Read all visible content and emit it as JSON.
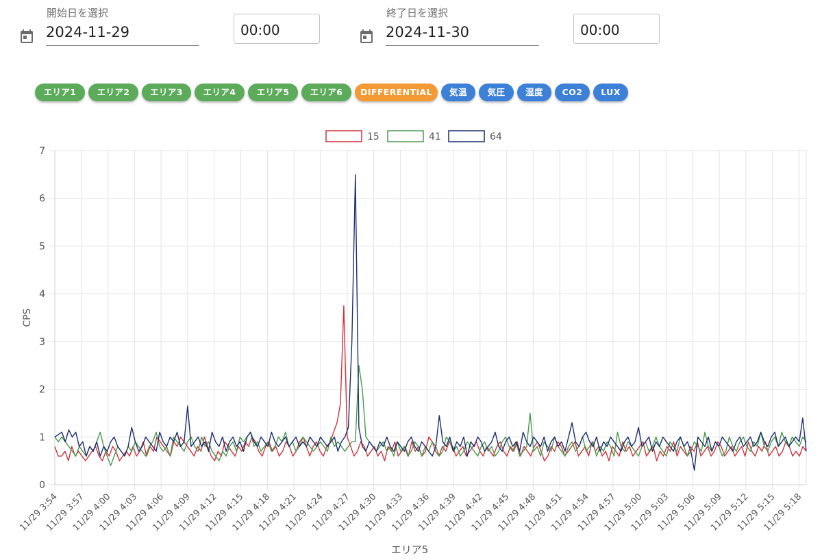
{
  "start": {
    "label": "開始日を選択",
    "date": "2024-11-29",
    "time": "00:00",
    "icon": "calendar-icon"
  },
  "end": {
    "label": "終了日を選択",
    "date": "2024-11-30",
    "time": "00:00",
    "icon": "calendar-icon"
  },
  "chips": [
    {
      "label": "エリア1",
      "color": "#5cab5a"
    },
    {
      "label": "エリア2",
      "color": "#5cab5a"
    },
    {
      "label": "エリア3",
      "color": "#5cab5a"
    },
    {
      "label": "エリア4",
      "color": "#5cab5a"
    },
    {
      "label": "エリア5",
      "color": "#5cab5a"
    },
    {
      "label": "エリア6",
      "color": "#5cab5a"
    },
    {
      "label": "DIFFERENTIAL",
      "color": "#f39a35"
    },
    {
      "label": "気温",
      "color": "#3c80d8"
    },
    {
      "label": "気圧",
      "color": "#3c80d8"
    },
    {
      "label": "湿度",
      "color": "#3c80d8"
    },
    {
      "label": "CO2",
      "color": "#3c80d8"
    },
    {
      "label": "LUX",
      "color": "#3c80d8"
    }
  ],
  "chart_data": {
    "type": "line",
    "title": "",
    "xlabel": "エリア5",
    "ylabel": "CPS",
    "ylim": [
      0,
      7
    ],
    "yticks": [
      0,
      1,
      2,
      3,
      4,
      5,
      6,
      7
    ],
    "grid": true,
    "legend_position": "top-center",
    "x_categories": [
      "11/29 3:54",
      "11/29 3:57",
      "11/29 4:00",
      "11/29 4:03",
      "11/29 4:06",
      "11/29 4:09",
      "11/29 4:12",
      "11/29 4:15",
      "11/29 4:18",
      "11/29 4:21",
      "11/29 4:24",
      "11/29 4:27",
      "11/29 4:30",
      "11/29 4:33",
      "11/29 4:36",
      "11/29 4:39",
      "11/29 4:42",
      "11/29 4:45",
      "11/29 4:48",
      "11/29 4:51",
      "11/29 4:54",
      "11/29 4:57",
      "11/29 5:00",
      "11/29 5:03",
      "11/29 5:06",
      "11/29 5:09",
      "11/29 5:12",
      "11/29 5:15",
      "11/29 5:18"
    ],
    "series": [
      {
        "name": "15",
        "color": "#d0323c",
        "values": [
          0.8,
          0.6,
          0.6,
          0.7,
          0.5,
          0.8,
          0.6,
          0.7,
          0.6,
          0.5,
          0.6,
          0.7,
          0.8,
          0.6,
          0.5,
          0.7,
          0.6,
          0.8,
          0.7,
          0.5,
          0.6,
          0.7,
          0.6,
          0.8,
          0.6,
          0.7,
          0.9,
          0.6,
          0.8,
          0.7,
          1.0,
          0.9,
          0.8,
          0.7,
          0.6,
          0.9,
          0.8,
          1.0,
          0.9,
          0.8,
          0.7,
          0.6,
          0.8,
          0.7,
          1.0,
          0.8,
          0.6,
          0.5,
          0.7,
          0.6,
          0.9,
          0.8,
          0.7,
          0.6,
          0.8,
          0.7,
          0.9,
          0.8,
          1.0,
          0.9,
          0.7,
          0.6,
          0.8,
          0.9,
          0.7,
          0.8,
          0.6,
          0.7,
          0.9,
          0.8,
          0.6,
          0.7,
          0.9,
          1.0,
          0.8,
          0.6,
          0.8,
          0.9,
          0.7,
          0.6,
          0.8,
          0.9,
          1.1,
          1.3,
          1.7,
          3.75,
          1.0,
          0.8,
          0.6,
          0.7,
          0.9,
          0.8,
          0.6,
          0.7,
          0.8,
          0.6,
          0.7,
          0.5,
          0.8,
          0.7,
          0.9,
          0.6,
          0.7,
          0.8,
          0.6,
          0.9,
          0.7,
          0.8,
          0.6,
          0.7,
          1.0,
          0.9,
          0.7,
          0.6,
          0.8,
          0.7,
          0.9,
          0.8,
          0.6,
          0.7,
          0.8,
          0.6,
          0.7,
          0.8,
          0.9,
          0.7,
          0.6,
          0.8,
          0.7,
          0.6,
          0.8,
          0.9,
          0.7,
          0.6,
          0.8,
          0.7,
          0.9,
          0.6,
          0.8,
          0.7,
          0.6,
          0.8,
          0.9,
          0.7,
          0.5,
          0.6,
          0.8,
          0.7,
          0.9,
          0.8,
          0.6,
          0.7,
          0.8,
          0.9,
          0.6,
          0.7,
          0.8,
          0.6,
          0.9,
          0.7,
          0.8,
          0.6,
          0.7,
          0.5,
          0.8,
          0.7,
          0.6,
          0.9,
          0.7,
          0.8,
          0.6,
          0.7,
          0.8,
          0.9,
          0.6,
          0.7,
          0.8,
          0.5,
          0.7,
          0.6,
          0.8,
          0.7,
          0.9,
          0.6,
          0.8,
          0.7,
          0.6,
          0.8,
          0.7,
          0.9,
          0.6,
          0.7,
          0.8,
          0.6,
          0.7,
          0.9,
          0.8,
          0.6,
          0.7,
          0.8,
          0.6,
          0.7,
          0.8,
          0.6,
          0.9,
          0.7,
          0.6,
          0.8,
          0.7,
          0.9,
          0.6,
          0.7,
          0.8,
          0.6,
          0.7,
          0.9,
          0.8,
          0.6,
          0.7,
          0.6,
          0.8,
          0.7
        ]
      },
      {
        "name": "41",
        "color": "#4a9a4f",
        "values": [
          1.0,
          0.9,
          1.0,
          0.9,
          0.8,
          0.7,
          0.6,
          0.8,
          0.7,
          0.6,
          0.8,
          0.7,
          0.9,
          1.1,
          0.8,
          0.6,
          0.4,
          0.6,
          0.8,
          0.7,
          0.6,
          0.8,
          0.7,
          0.9,
          0.8,
          0.7,
          0.6,
          0.8,
          0.9,
          1.1,
          0.8,
          0.7,
          0.8,
          0.6,
          1.0,
          0.9,
          0.8,
          0.7,
          0.9,
          1.0,
          0.8,
          0.7,
          1.0,
          0.8,
          0.9,
          0.7,
          0.6,
          0.5,
          0.7,
          0.6,
          0.8,
          0.9,
          0.7,
          1.0,
          0.9,
          1.0,
          1.1,
          0.8,
          0.9,
          0.7,
          0.8,
          0.9,
          0.7,
          0.8,
          1.0,
          0.9,
          1.1,
          0.8,
          0.9,
          0.7,
          0.8,
          1.0,
          0.9,
          0.8,
          0.7,
          0.8,
          0.9,
          0.8,
          0.7,
          1.0,
          0.8,
          0.9,
          0.8,
          0.7,
          0.8,
          0.9,
          0.9,
          2.5,
          2.0,
          1.0,
          0.9,
          0.8,
          0.7,
          0.8,
          0.9,
          0.7,
          0.8,
          0.6,
          0.9,
          0.7,
          0.8,
          0.6,
          0.7,
          0.9,
          0.8,
          0.6,
          0.8,
          0.7,
          0.9,
          0.8,
          0.6,
          0.7,
          1.0,
          0.9,
          0.7,
          0.8,
          0.6,
          0.7,
          0.9,
          0.8,
          0.7,
          0.6,
          0.8,
          0.9,
          0.7,
          0.8,
          0.6,
          0.7,
          0.9,
          1.0,
          0.8,
          0.7,
          0.9,
          0.6,
          0.7,
          0.8,
          1.5,
          0.7,
          0.8,
          0.6,
          0.9,
          0.8,
          0.7,
          1.0,
          0.8,
          0.7,
          0.6,
          0.8,
          0.9,
          0.7,
          0.8,
          1.0,
          0.7,
          0.8,
          0.9,
          0.6,
          0.8,
          0.7,
          0.9,
          0.8,
          0.6,
          1.1,
          0.8,
          0.7,
          0.9,
          0.8,
          0.7,
          0.6,
          0.8,
          0.9,
          0.7,
          0.8,
          1.0,
          0.8,
          0.7,
          0.6,
          0.9,
          0.8,
          0.7,
          1.0,
          0.8,
          0.6,
          0.7,
          0.9,
          0.8,
          0.7,
          1.1,
          0.8,
          0.7,
          0.9,
          0.8,
          0.6,
          0.7,
          1.0,
          0.8,
          0.7,
          0.9,
          1.0,
          0.8,
          0.7,
          0.9,
          0.8,
          1.1,
          0.8,
          0.7,
          0.9,
          1.0,
          0.8,
          1.1,
          0.9,
          0.8,
          1.0,
          0.9,
          0.8,
          1.0,
          0.9
        ]
      },
      {
        "name": "64",
        "color": "#1c2f6b",
        "values": [
          1.0,
          1.05,
          1.1,
          0.9,
          1.15,
          1.0,
          1.1,
          0.8,
          0.9,
          0.6,
          0.8,
          0.7,
          0.9,
          0.6,
          0.8,
          0.7,
          0.9,
          1.0,
          0.8,
          0.7,
          0.6,
          0.8,
          1.2,
          0.9,
          0.7,
          0.8,
          1.0,
          0.9,
          0.8,
          0.7,
          1.1,
          0.9,
          0.8,
          1.0,
          0.9,
          1.1,
          0.8,
          0.9,
          1.65,
          0.8,
          0.9,
          1.0,
          0.8,
          0.9,
          0.7,
          1.1,
          0.9,
          0.8,
          1.0,
          0.7,
          0.9,
          1.0,
          0.8,
          0.9,
          0.7,
          1.0,
          1.1,
          0.9,
          0.8,
          1.0,
          0.9,
          0.8,
          1.1,
          0.9,
          0.8,
          0.9,
          1.0,
          0.8,
          0.9,
          1.0,
          0.8,
          0.9,
          0.8,
          1.0,
          0.9,
          0.8,
          1.0,
          0.9,
          0.8,
          0.9,
          1.0,
          0.7,
          0.9,
          1.0,
          1.2,
          3.0,
          6.5,
          1.2,
          0.8,
          0.7,
          0.9,
          0.8,
          0.7,
          0.9,
          0.8,
          1.0,
          0.8,
          0.7,
          0.9,
          0.8,
          0.7,
          0.9,
          1.0,
          0.8,
          0.7,
          0.9,
          0.8,
          0.7,
          0.6,
          0.8,
          1.45,
          0.9,
          0.8,
          1.0,
          0.7,
          0.9,
          0.8,
          1.0,
          0.6,
          0.9,
          0.8,
          1.0,
          0.9,
          0.7,
          0.8,
          0.9,
          1.1,
          0.8,
          0.7,
          0.9,
          1.0,
          0.8,
          0.9,
          0.7,
          1.1,
          0.9,
          0.8,
          1.0,
          0.9,
          0.8,
          1.0,
          0.7,
          0.9,
          1.0,
          0.8,
          0.9,
          0.7,
          1.0,
          1.3,
          0.9,
          0.8,
          1.0,
          1.1,
          0.9,
          0.8,
          1.0,
          0.7,
          0.9,
          0.8,
          1.0,
          0.9,
          0.8,
          0.7,
          0.9,
          1.0,
          0.8,
          0.9,
          1.2,
          0.8,
          0.9,
          1.0,
          0.7,
          0.9,
          0.8,
          1.0,
          0.9,
          0.8,
          0.7,
          0.9,
          1.0,
          0.8,
          0.9,
          0.7,
          0.3,
          1.0,
          0.9,
          0.8,
          1.0,
          0.7,
          0.9,
          0.8,
          1.0,
          0.9,
          0.8,
          0.7,
          0.9,
          1.0,
          0.8,
          0.9,
          1.0,
          0.8,
          0.9,
          1.1,
          0.9,
          0.8,
          1.0,
          1.1,
          0.8,
          0.9,
          1.0,
          0.8,
          0.9,
          1.0,
          0.9,
          1.4,
          0.7
        ]
      }
    ]
  }
}
